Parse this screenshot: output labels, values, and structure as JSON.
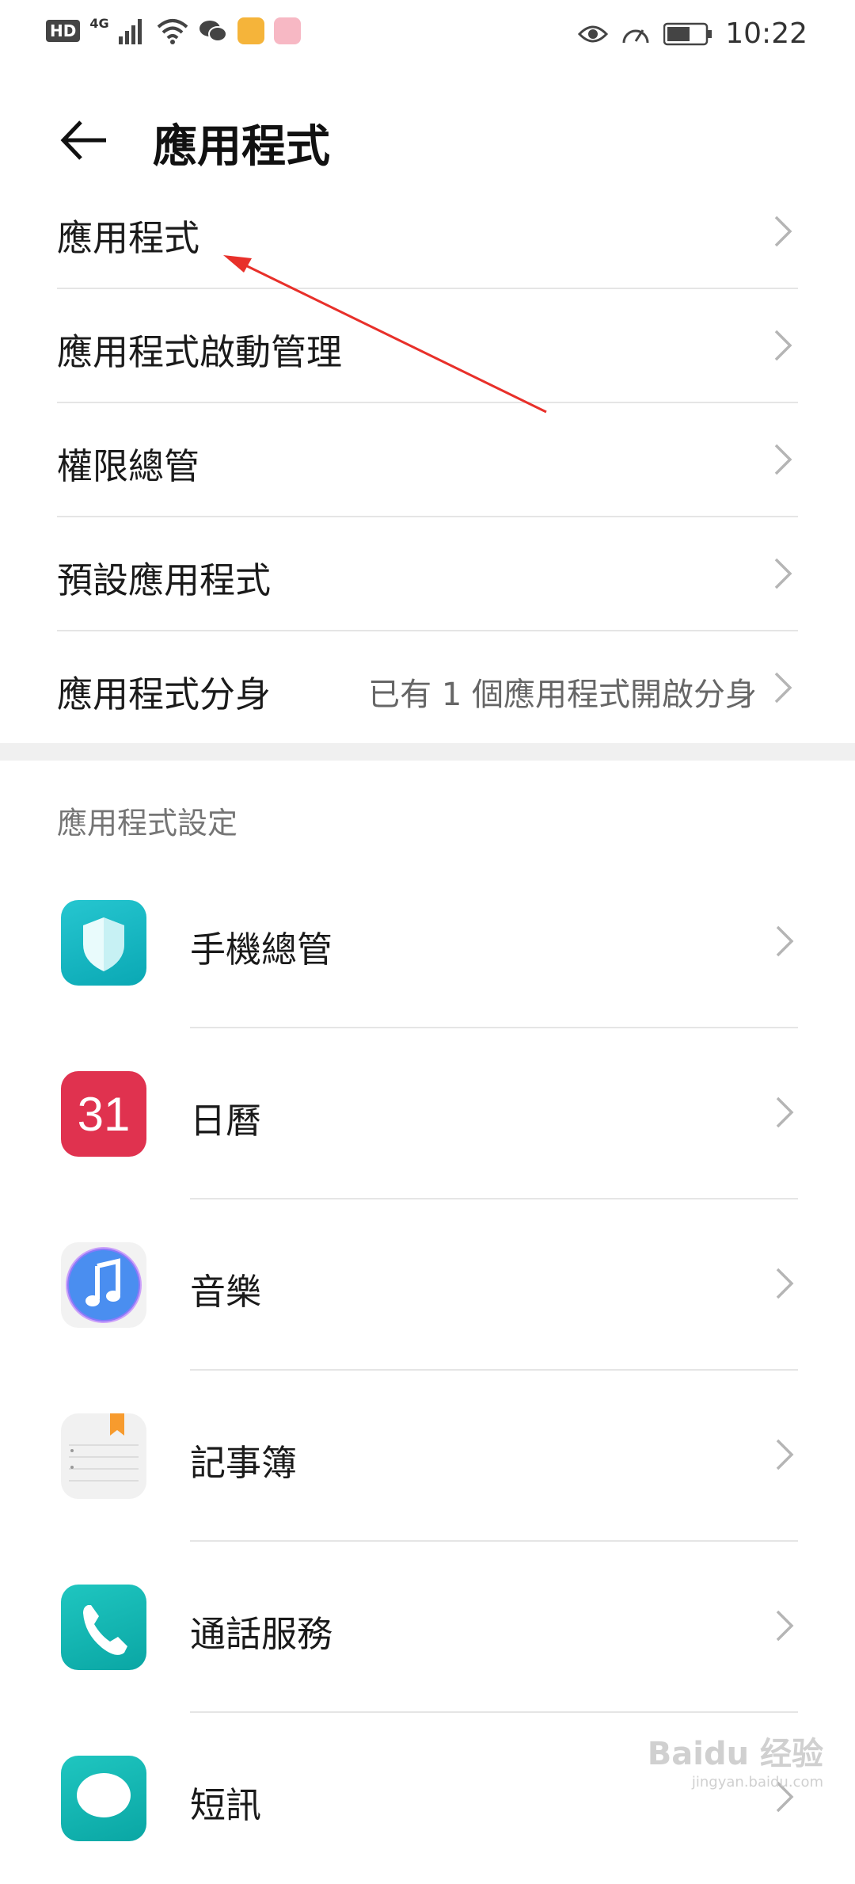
{
  "status_bar": {
    "network_badge": "HD",
    "signal_label": "4G",
    "time": "10:22"
  },
  "header": {
    "title": "應用程式"
  },
  "menu": {
    "items": [
      {
        "label": "應用程式"
      },
      {
        "label": "應用程式啟動管理"
      },
      {
        "label": "權限總管"
      },
      {
        "label": "預設應用程式"
      },
      {
        "label": "應用程式分身",
        "value": "已有 1 個應用程式開啟分身"
      }
    ]
  },
  "section": {
    "title": "應用程式設定"
  },
  "apps": [
    {
      "label": "手機總管",
      "icon": "phone-manager-icon"
    },
    {
      "label": "日曆",
      "icon": "calendar-icon",
      "icon_text": "31"
    },
    {
      "label": "音樂",
      "icon": "music-icon"
    },
    {
      "label": "記事簿",
      "icon": "notepad-icon"
    },
    {
      "label": "通話服務",
      "icon": "phone-call-icon"
    },
    {
      "label": "短訊",
      "icon": "message-icon"
    }
  ],
  "watermark": {
    "text": "Baidu 经验",
    "sub": "jingyan.baidu.com"
  },
  "colors": {
    "accent_red": "#e8302a",
    "teal": "#12b3b8",
    "calendar_red": "#e0324f"
  }
}
